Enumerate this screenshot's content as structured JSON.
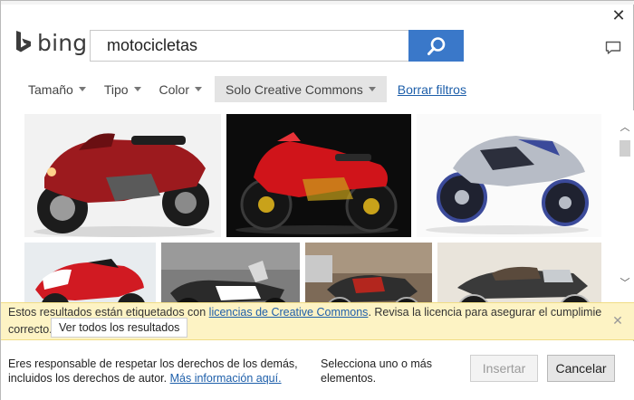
{
  "brand": {
    "name": "bing"
  },
  "search": {
    "value": "motocicletas",
    "button_icon": "search-icon"
  },
  "filters": {
    "size": "Tamaño",
    "type": "Tipo",
    "color": "Color",
    "license": "Solo Creative Commons",
    "clear": "Borrar filtros"
  },
  "results": [
    {
      "name": "result-red-touring-motorcycle",
      "colors": {
        "body": "#9c1a1e",
        "bg": "#f2f2f2"
      }
    },
    {
      "name": "result-red-sport-bike-black-bg",
      "colors": {
        "body": "#d0141a",
        "bg": "#0c0c0c"
      }
    },
    {
      "name": "result-silver-blue-concept-bike",
      "colors": {
        "body": "#b7bcc6",
        "bg": "#fafafa"
      }
    },
    {
      "name": "result-red-white-superbike",
      "colors": {
        "body": "#d11a22",
        "bg": "#e8ecef"
      }
    },
    {
      "name": "result-black-white-cruiser",
      "colors": {
        "body": "#2a2a2a",
        "bg": "#7d7d7d"
      }
    },
    {
      "name": "result-vintage-red-motorcycle",
      "colors": {
        "body": "#b3261e",
        "bg": "#7d6a57"
      }
    },
    {
      "name": "result-classic-chrome-motorcycle",
      "colors": {
        "body": "#3a3a3a",
        "bg": "#e9e4db"
      }
    }
  ],
  "infobar": {
    "text_before": "Estos resultados están etiquetados con ",
    "link": "licencias de Creative Commons",
    "text_after": ". Revisa la licencia para asegurar el cumplimiento",
    "line2": "correcto.",
    "view_all": "Ver todos los resultados"
  },
  "footer": {
    "responsibility_text": "Eres responsable de respetar los derechos de los demás, incluidos los derechos de autor.",
    "more_info_link": "Más información aquí.",
    "selection_hint": "Selecciona uno o más elementos.",
    "insert": "Insertar",
    "cancel": "Cancelar"
  },
  "colors": {
    "accent": "#3a78c9",
    "link": "#1e5faa",
    "infobar_bg": "#fdf3c4",
    "logo": "#1f9a93"
  }
}
